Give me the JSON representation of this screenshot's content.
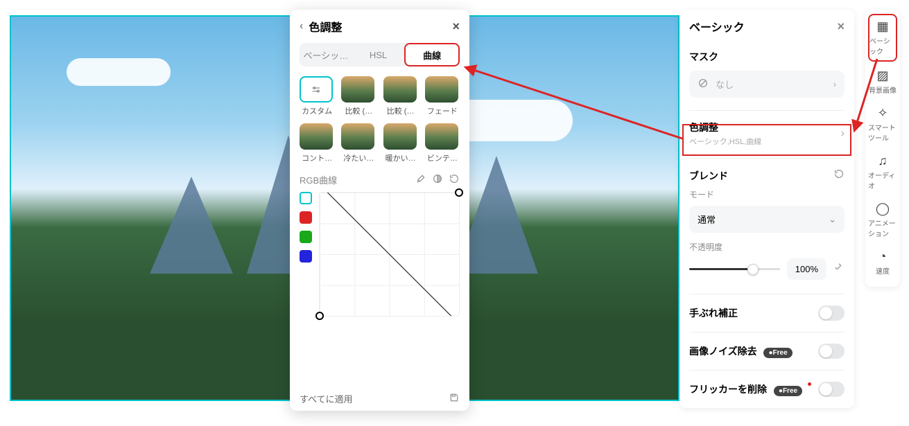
{
  "popup": {
    "title": "色調整",
    "tabs": [
      "ベーシッ…",
      "HSL",
      "曲線"
    ],
    "presets": [
      "カスタム",
      "比較 (…",
      "比較 (…",
      "フェード",
      "コント…",
      "冷たい…",
      "暖かい…",
      "ビンテ…"
    ],
    "curve_label": "RGB曲線",
    "footer": "すべてに適用"
  },
  "sidebar": {
    "title": "ベーシック",
    "mask_title": "マスク",
    "mask_value": "なし",
    "color_adjust": {
      "title": "色調整",
      "subtitle": "ベーシック,HSL,曲線"
    },
    "blend_title": "ブレンド",
    "blend_mode_label": "モード",
    "blend_mode_value": "通常",
    "opacity_label": "不透明度",
    "opacity_value": "100%",
    "stabilize": "手ぶれ補正",
    "denoise": "画像ノイズ除去",
    "flicker": "フリッカーを削除",
    "free": "Free"
  },
  "rail": [
    "ベーシック",
    "背景画像",
    "スマートツール",
    "オーディオ",
    "アニメーション",
    "速度"
  ]
}
